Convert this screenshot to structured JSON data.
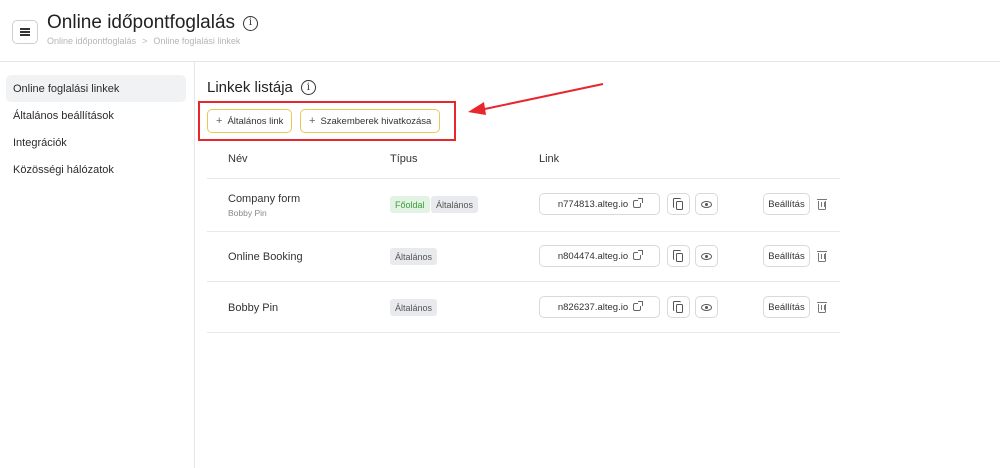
{
  "header": {
    "title": "Online időpontfoglalás",
    "breadcrumb": [
      "Online időpontfoglalás",
      ">",
      "Online foglalási linkek"
    ]
  },
  "sidebar": {
    "items": [
      {
        "label": "Online foglalási linkek",
        "active": true
      },
      {
        "label": "Általános beállítások"
      },
      {
        "label": "Integrációk"
      },
      {
        "label": "Közösségi hálózatok"
      }
    ]
  },
  "main": {
    "section_title": "Linkek listája",
    "buttons": {
      "general_link": "Általános link",
      "staff_link": "Szakemberek hivatkozása"
    },
    "table": {
      "columns": [
        "Név",
        "Típus",
        "Link"
      ],
      "rows": [
        {
          "name": "Company form",
          "sub": "Bobby Pin",
          "tags": [
            "Főoldal",
            "Általános"
          ],
          "link": "n774813.alteg.io",
          "settings": "Beállítás"
        },
        {
          "name": "Online Booking",
          "sub": "",
          "tags": [
            "Általános"
          ],
          "link": "n804474.alteg.io",
          "settings": "Beállítás"
        },
        {
          "name": "Bobby Pin",
          "sub": "",
          "tags": [
            "Általános"
          ],
          "link": "n826237.alteg.io",
          "settings": "Beállítás"
        }
      ]
    }
  },
  "colors": {
    "highlight": "#e8262d",
    "button_border": "#e6c95a",
    "tag_green_text": "#3b9a3b"
  },
  "icons": [
    "menu-icon",
    "info-icon",
    "plus-icon",
    "external-link-icon",
    "copy-icon",
    "eye-icon",
    "trash-icon"
  ]
}
